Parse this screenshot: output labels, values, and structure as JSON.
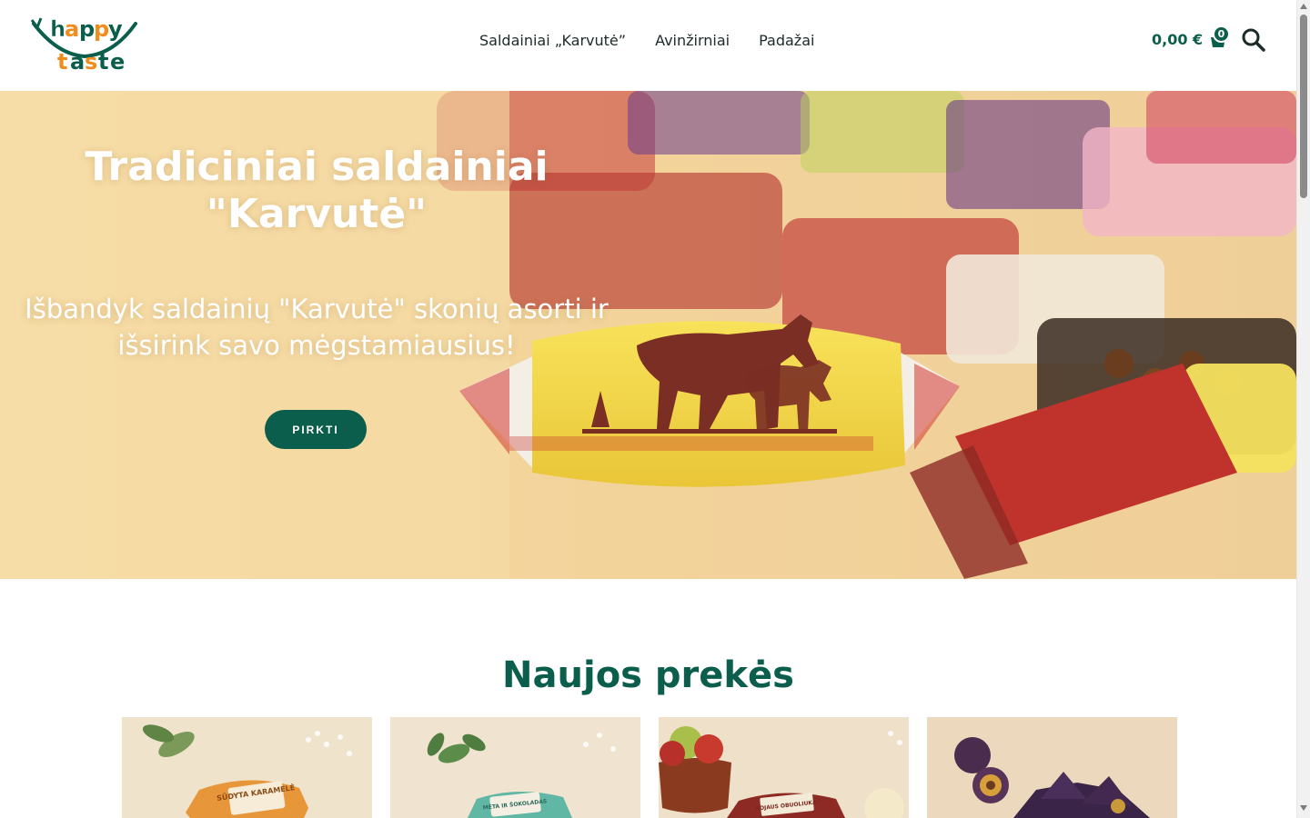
{
  "brand": {
    "logo_line1": "happy",
    "logo_line2": "taste"
  },
  "nav": {
    "items": [
      {
        "label": "Saldainiai „Karvutė”"
      },
      {
        "label": "Avinžirniai"
      },
      {
        "label": "Padažai"
      }
    ]
  },
  "cart": {
    "total": "0,00 €",
    "count": "0"
  },
  "hero": {
    "title": "Tradiciniai saldainiai \"Karvutė\"",
    "subtitle": "Išbandyk saldainių \"Karvutė\" skonių asorti ir išsirink savo mėgstamiausius!",
    "button": "PIRKTI"
  },
  "new_products": {
    "title": "Naujos prekės",
    "items": [
      {
        "wrapper_text": "SŪDYTA KARAMELĖ"
      },
      {
        "wrapper_text": "MĖTA IR ŠOKOLADAS"
      },
      {
        "wrapper_text": "ROJAUS OBUOLIUKAI"
      },
      {
        "wrapper_text": ""
      }
    ]
  },
  "colors": {
    "accent": "#0b5e4c",
    "logo_orange": "#f28c1c",
    "hero_bg": "#f4d79c"
  },
  "icons": [
    "cart-icon",
    "search-icon",
    "scroll-up-icon",
    "scroll-down-icon"
  ]
}
